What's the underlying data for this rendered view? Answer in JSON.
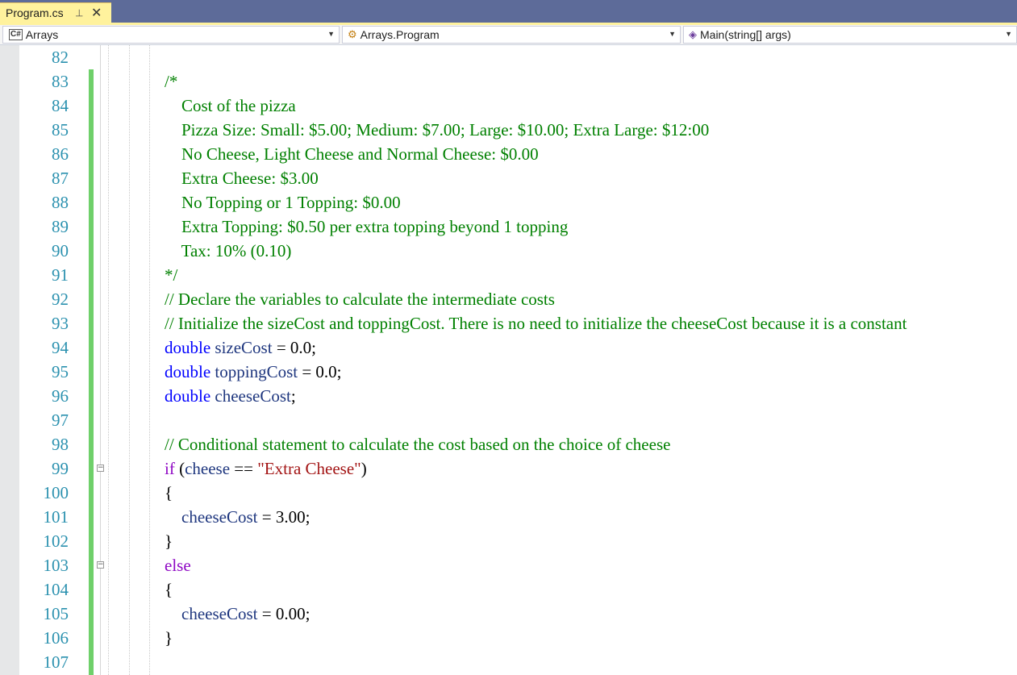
{
  "tab": {
    "label": "Program.cs",
    "pin_icon": "pin-icon",
    "close_glyph": "✕"
  },
  "navbar": {
    "project": "Arrays",
    "type": "Arrays.Program",
    "member": "Main(string[] args)"
  },
  "colors": {
    "comment": "#008000",
    "keyword": "#0000ff",
    "control": "#8f08c4",
    "variable": "#1f377f",
    "string": "#a31515",
    "line_number": "#2b91af",
    "change_bar": "#6fd06a",
    "tab_active": "#fff29d",
    "tab_strip": "#5d6b99"
  },
  "lines": [
    {
      "n": "82",
      "tokens": []
    },
    {
      "n": "83",
      "tokens": [
        [
          "comment",
          "/*"
        ]
      ]
    },
    {
      "n": "84",
      "tokens": [
        [
          "comment",
          "    Cost of the pizza"
        ]
      ]
    },
    {
      "n": "85",
      "tokens": [
        [
          "comment",
          "    Pizza Size: Small: $5.00; Medium: $7.00; Large: $10.00; Extra Large: $12:00"
        ]
      ]
    },
    {
      "n": "86",
      "tokens": [
        [
          "comment",
          "    No Cheese, Light Cheese and Normal Cheese: $0.00"
        ]
      ]
    },
    {
      "n": "87",
      "tokens": [
        [
          "comment",
          "    Extra Cheese: $3.00"
        ]
      ]
    },
    {
      "n": "88",
      "tokens": [
        [
          "comment",
          "    No Topping or 1 Topping: $0.00"
        ]
      ]
    },
    {
      "n": "89",
      "tokens": [
        [
          "comment",
          "    Extra Topping: $0.50 per extra topping beyond 1 topping"
        ]
      ]
    },
    {
      "n": "90",
      "tokens": [
        [
          "comment",
          "    Tax: 10% (0.10)"
        ]
      ]
    },
    {
      "n": "91",
      "tokens": [
        [
          "comment",
          "*/"
        ]
      ]
    },
    {
      "n": "92",
      "tokens": [
        [
          "comment",
          "// Declare the variables to calculate the intermediate costs"
        ]
      ]
    },
    {
      "n": "93",
      "tokens": [
        [
          "comment",
          "// Initialize the sizeCost and toppingCost. There is no need to initialize the cheeseCost because it is a constant"
        ]
      ]
    },
    {
      "n": "94",
      "tokens": [
        [
          "kw",
          "double"
        ],
        [
          "plain",
          " "
        ],
        [
          "var",
          "sizeCost"
        ],
        [
          "plain",
          " = 0.0;"
        ]
      ]
    },
    {
      "n": "95",
      "tokens": [
        [
          "kw",
          "double"
        ],
        [
          "plain",
          " "
        ],
        [
          "var",
          "toppingCost"
        ],
        [
          "plain",
          " = 0.0;"
        ]
      ]
    },
    {
      "n": "96",
      "tokens": [
        [
          "kw",
          "double"
        ],
        [
          "plain",
          " "
        ],
        [
          "var",
          "cheeseCost"
        ],
        [
          "plain",
          ";"
        ]
      ]
    },
    {
      "n": "97",
      "tokens": []
    },
    {
      "n": "98",
      "tokens": [
        [
          "comment",
          "// Conditional statement to calculate the cost based on the choice of cheese"
        ]
      ]
    },
    {
      "n": "99",
      "fold": "−",
      "tokens": [
        [
          "ctrl",
          "if"
        ],
        [
          "plain",
          " ("
        ],
        [
          "var",
          "cheese"
        ],
        [
          "plain",
          " == "
        ],
        [
          "str",
          "\"Extra Cheese\""
        ],
        [
          "plain",
          ")"
        ]
      ]
    },
    {
      "n": "100",
      "tokens": [
        [
          "plain",
          "{"
        ]
      ]
    },
    {
      "n": "101",
      "tokens": [
        [
          "plain",
          "    "
        ],
        [
          "var",
          "cheeseCost"
        ],
        [
          "plain",
          " = 3.00;"
        ]
      ]
    },
    {
      "n": "102",
      "tokens": [
        [
          "plain",
          "}"
        ]
      ]
    },
    {
      "n": "103",
      "fold": "−",
      "tokens": [
        [
          "ctrl",
          "else"
        ]
      ]
    },
    {
      "n": "104",
      "tokens": [
        [
          "plain",
          "{"
        ]
      ]
    },
    {
      "n": "105",
      "tokens": [
        [
          "plain",
          "    "
        ],
        [
          "var",
          "cheeseCost"
        ],
        [
          "plain",
          " = 0.00;"
        ]
      ]
    },
    {
      "n": "106",
      "tokens": [
        [
          "plain",
          "}"
        ]
      ]
    },
    {
      "n": "107",
      "tokens": []
    }
  ]
}
